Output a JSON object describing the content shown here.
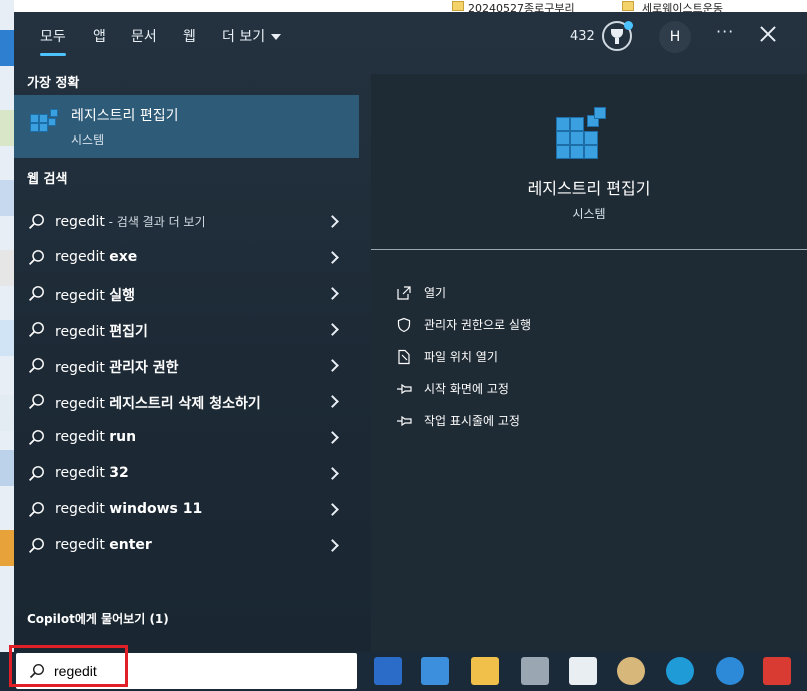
{
  "desktop": {
    "top_files": [
      "20240527종로구부리",
      "세로웨이스트운동"
    ]
  },
  "header": {
    "tabs": [
      {
        "label": "모두",
        "active": true
      },
      {
        "label": "앱"
      },
      {
        "label": "문서"
      },
      {
        "label": "웹"
      },
      {
        "label": "더 보기"
      }
    ],
    "points": "432",
    "avatar_initial": "H",
    "more_label": "···",
    "icons": [
      "rewards-trophy-icon",
      "more-icon",
      "close-icon"
    ]
  },
  "results": {
    "best_match_heading": "가장 정확",
    "best_match": {
      "name": "레지스트리 편집기",
      "type": "시스템",
      "icon": "registry-editor-icon"
    },
    "web_heading": "웹 검색",
    "web_items": [
      {
        "prefix": "regedit",
        "bold": "",
        "hint": " - 검색 결과 더 보기"
      },
      {
        "prefix": "regedit ",
        "bold": "exe",
        "hint": ""
      },
      {
        "prefix": "regedit ",
        "bold": "실행",
        "hint": ""
      },
      {
        "prefix": "regedit ",
        "bold": "편집기",
        "hint": ""
      },
      {
        "prefix": "regedit ",
        "bold": "관리자 권한",
        "hint": ""
      },
      {
        "prefix": "regedit ",
        "bold": "레지스트리 삭제 청소하기",
        "hint": ""
      },
      {
        "prefix": "regedit ",
        "bold": "run",
        "hint": ""
      },
      {
        "prefix": "regedit ",
        "bold": "32",
        "hint": ""
      },
      {
        "prefix": "regedit ",
        "bold": "windows 11",
        "hint": ""
      },
      {
        "prefix": "regedit ",
        "bold": "enter",
        "hint": ""
      }
    ],
    "copilot_label": "Copilot에게 물어보기 (1)"
  },
  "detail": {
    "name": "레지스트리 편집기",
    "type": "시스템",
    "actions": [
      {
        "label": "열기",
        "icon": "open-icon"
      },
      {
        "label": "관리자 권한으로 실행",
        "icon": "shield-icon"
      },
      {
        "label": "파일 위치 열기",
        "icon": "file-location-icon"
      },
      {
        "label": "시작 화면에 고정",
        "icon": "pin-icon"
      },
      {
        "label": "작업 표시줄에 고정",
        "icon": "pin-icon"
      }
    ]
  },
  "taskbar": {
    "search_value": "regedit",
    "apps": [
      "store-icon",
      "mail-icon",
      "file-explorer-icon",
      "calculator-icon",
      "wordpad-icon",
      "paint-icon",
      "edge-icon",
      "internet-explorer-icon",
      "app-red-icon"
    ]
  },
  "colors": {
    "accent": "#4cc2ff",
    "highlight_box": "#e01f26",
    "selected_row": "#2e5b78"
  }
}
